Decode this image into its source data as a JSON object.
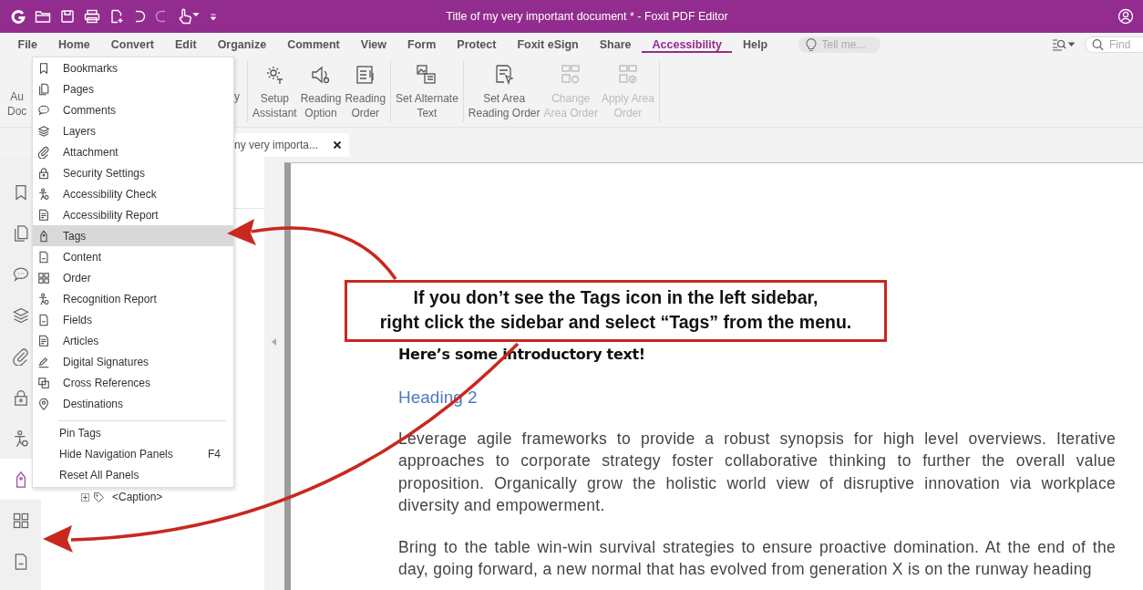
{
  "title_bar": {
    "title": "Title of my very important document * - Foxit PDF Editor"
  },
  "menu_tabs": [
    {
      "label": "File",
      "selected": false
    },
    {
      "label": "Home",
      "selected": false
    },
    {
      "label": "Convert",
      "selected": false
    },
    {
      "label": "Edit",
      "selected": false
    },
    {
      "label": "Organize",
      "selected": false
    },
    {
      "label": "Comment",
      "selected": false
    },
    {
      "label": "View",
      "selected": false
    },
    {
      "label": "Form",
      "selected": false
    },
    {
      "label": "Protect",
      "selected": false
    },
    {
      "label": "Foxit eSign",
      "selected": false
    },
    {
      "label": "Share",
      "selected": false
    },
    {
      "label": "Accessibility",
      "selected": true
    },
    {
      "label": "Help",
      "selected": false
    }
  ],
  "tell_me": {
    "placeholder": "Tell me..."
  },
  "find": {
    "placeholder": "Find"
  },
  "ribbon": {
    "groups": [
      {
        "buttons": [
          {
            "label": "Au\nDoc"
          },
          {
            "label": "y"
          }
        ]
      },
      {
        "buttons": [
          {
            "label": "Setup\nAssistant",
            "disabled": false
          },
          {
            "label": "Reading\nOption",
            "disabled": false
          },
          {
            "label": "Reading\nOrder",
            "disabled": false
          }
        ]
      },
      {
        "buttons": [
          {
            "label": "Set Alternate\nText",
            "disabled": false
          }
        ]
      },
      {
        "buttons": [
          {
            "label": "Set Area\nReading Order",
            "disabled": false
          },
          {
            "label": "Change\nArea Order",
            "disabled": true
          },
          {
            "label": "Apply Area\nOrder",
            "disabled": true
          }
        ]
      }
    ]
  },
  "document_tab": {
    "title": "ny very importa..."
  },
  "sidebar_tabs": [
    {
      "selected": false
    },
    {
      "selected": false
    },
    {
      "selected": false
    },
    {
      "selected": false
    },
    {
      "selected": false
    },
    {
      "selected": false
    },
    {
      "selected": false
    },
    {
      "selected": true
    },
    {
      "selected": false
    },
    {
      "selected": false
    }
  ],
  "tag_tree": [
    {
      "label": "<Caption>",
      "expanded": false
    }
  ],
  "context_menu": {
    "items": [
      {
        "label": "Bookmarks",
        "selected": false
      },
      {
        "label": "Pages",
        "selected": false
      },
      {
        "label": "Comments",
        "selected": false
      },
      {
        "label": "Layers",
        "selected": false
      },
      {
        "label": "Attachment",
        "selected": false
      },
      {
        "label": "Security Settings",
        "selected": false
      },
      {
        "label": "Accessibility Check",
        "selected": false
      },
      {
        "label": "Accessibility Report",
        "selected": false
      },
      {
        "label": "Tags",
        "selected": true
      },
      {
        "label": "Content",
        "selected": false
      },
      {
        "label": "Order",
        "selected": false
      },
      {
        "label": "Recognition Report",
        "selected": false
      },
      {
        "label": "Fields",
        "selected": false
      },
      {
        "label": "Articles",
        "selected": false
      },
      {
        "label": "Digital Signatures",
        "selected": false
      },
      {
        "label": "Cross References",
        "selected": false
      },
      {
        "label": "Destinations",
        "selected": false
      }
    ],
    "actions": [
      {
        "label": "Pin Tags"
      },
      {
        "label": "Hide Navigation Panels",
        "shortcut": "F4"
      },
      {
        "label": "Reset All Panels"
      }
    ]
  },
  "document": {
    "intro": "Here’s some introductory text!",
    "heading": "Heading 2",
    "paragraphs": [
      "Leverage agile frameworks to provide a robust synopsis for high level overviews. Iterative approaches to corporate strategy foster collaborative thinking to further the overall value proposition. Organically grow the holistic world view of disruptive innovation via workplace diversity and empowerment.",
      "Bring to the table win-win survival strategies to ensure proactive domination. At the end of the day, going forward, a new normal that has evolved from generation X is on the runway heading"
    ]
  },
  "callout": {
    "text": "If you don’t see the Tags icon in the left sidebar,\nright click the sidebar and select “Tags” from the menu."
  }
}
